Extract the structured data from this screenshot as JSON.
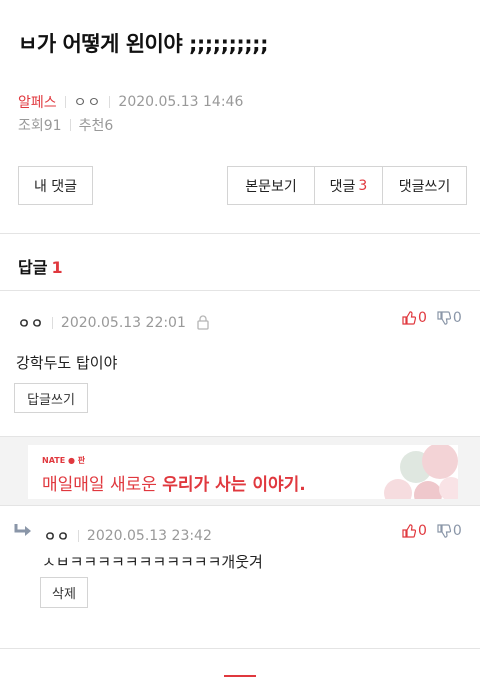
{
  "post": {
    "title": "ㅂ가 어떻게 왼이야 ;;;;;;;;;;",
    "category": "알페스",
    "author": "ㅇㅇ",
    "datetime": "2020.05.13 14:46",
    "views": "조회91",
    "recommends": "추천6"
  },
  "toolbar": {
    "my_comments": "내 댓글",
    "view_body": "본문보기",
    "comments_label": "댓글",
    "comments_count": "3",
    "write_comment": "댓글쓰기"
  },
  "replies": {
    "label": "답글",
    "count": "1"
  },
  "comment": {
    "author": "ㅇㅇ",
    "datetime": "2020.05.13 22:01",
    "text": "강학두도 탑이야",
    "up": "0",
    "down": "0",
    "reply_button": "답글쓰기"
  },
  "ad": {
    "logo": "NATE ● 판",
    "text_plain": "매일매일 새로운 ",
    "text_bold": "우리가 사는 이야기."
  },
  "reply": {
    "author": "ㅇㅇ",
    "datetime": "2020.05.13 23:42",
    "text": "ㅅㅂㅋㅋㅋㅋㅋㅋㅋㅋㅋㅋㅋ개웃겨",
    "up": "0",
    "down": "0",
    "delete_button": "삭제"
  },
  "colors": {
    "accent": "#e0383e",
    "muted": "#999999",
    "down_vote": "#8a96a8"
  }
}
